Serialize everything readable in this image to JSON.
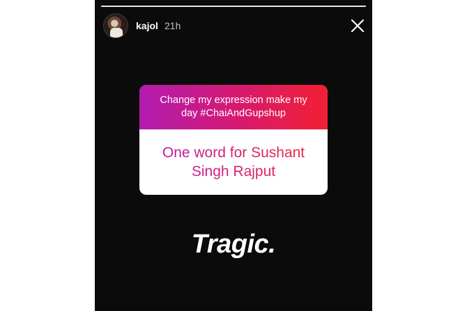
{
  "story": {
    "progress": 1.0,
    "user": {
      "username": "kajol",
      "time_ago": "21h"
    },
    "close_icon": "close-icon",
    "question_sticker": {
      "prompt_lines": [
        "Change my expression make my",
        "day  #ChaiAndGupshup"
      ],
      "question": "One word for Sushant Singh Rajput"
    },
    "answer": "Tragic."
  },
  "colors": {
    "background": "#0b0b0b",
    "sticker_gradient_start": "#b21bb0",
    "sticker_gradient_end": "#f21f32",
    "text_white": "#ffffff"
  }
}
